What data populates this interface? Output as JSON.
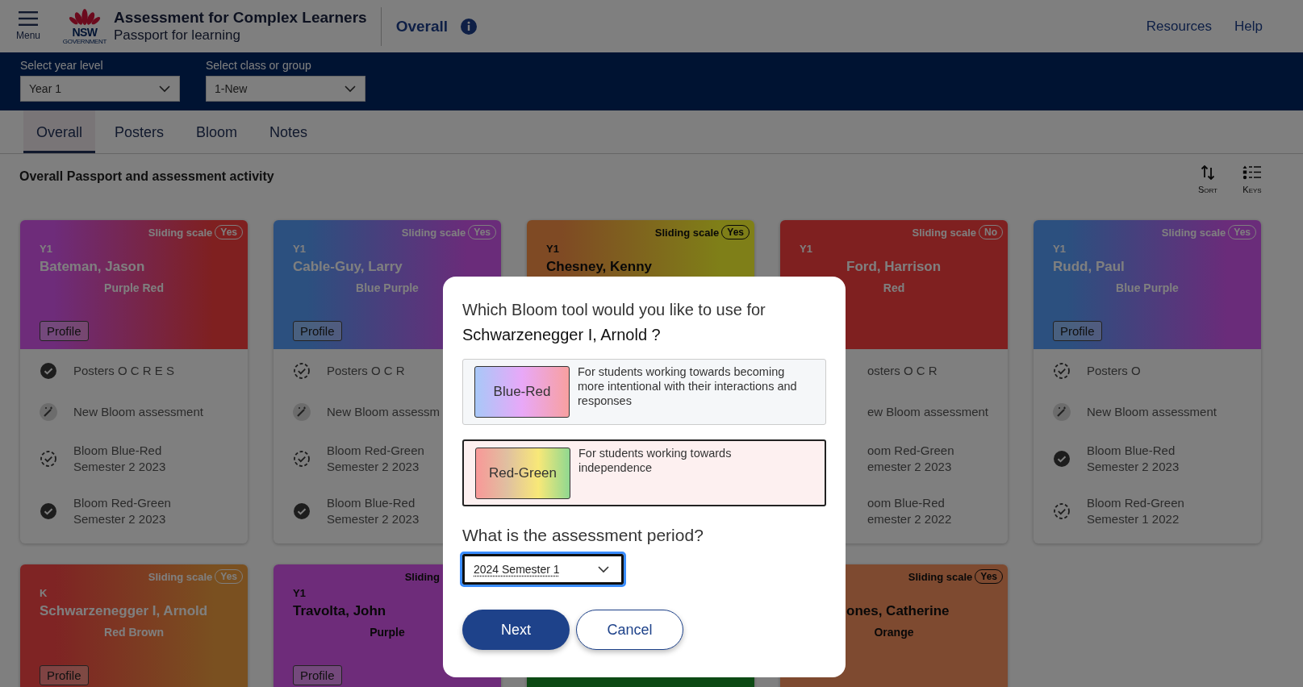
{
  "header": {
    "menu": "Menu",
    "logo": "NSW",
    "logo_sub": "GOVERNMENT",
    "title": "Assessment for Complex Learners",
    "subtitle": "Passport for learning",
    "page": "Overall",
    "links": [
      "Resources",
      "Help"
    ]
  },
  "filters": [
    {
      "label": "Select year level",
      "value": "Year 1"
    },
    {
      "label": "Select class or group",
      "value": "1-New"
    }
  ],
  "tabs": [
    {
      "label": "Overall",
      "selected": true
    },
    {
      "label": "Posters",
      "selected": false
    },
    {
      "label": "Bloom",
      "selected": false
    },
    {
      "label": "Notes",
      "selected": false
    }
  ],
  "section": {
    "title": "Overall Passport and assessment activity",
    "tools": [
      {
        "kind": "sort",
        "label": "Sort"
      },
      {
        "kind": "keys",
        "label": "Keys"
      }
    ]
  },
  "cards": [
    {
      "gradient": [
        {
          "color": "#6e2c7a"
        },
        {
          "color": "#7f2020"
        }
      ],
      "dark_text": false,
      "scale": "Sliding scale",
      "scale_value": "Yes",
      "level": "Y1",
      "name": "Bateman, Jason",
      "band": "Purple Red",
      "profile": "Profile",
      "covered": false,
      "items": [
        {
          "kind": "done",
          "text": "Posters O C R E S"
        },
        {
          "kind": "new",
          "text": "New Bloom assessment"
        },
        {
          "kind": "pending",
          "text": "Bloom Blue-Red",
          "period": "Semester 2 2023"
        },
        {
          "kind": "done",
          "text": "Bloom Red-Green",
          "period": "Semester 2 2023"
        }
      ]
    },
    {
      "gradient": [
        {
          "color": "#2c5088"
        },
        {
          "color": "#6a2c7a"
        }
      ],
      "dark_text": false,
      "scale": "Sliding scale",
      "scale_value": "Yes",
      "level": "Y1",
      "name": "Cable-Guy, Larry",
      "band": "Blue Purple",
      "profile": "Profile",
      "covered": false,
      "items": [
        {
          "kind": "pending",
          "text": "Posters O C R"
        },
        {
          "kind": "new",
          "text": "New Bloom assessm"
        },
        {
          "kind": "pending",
          "text": "Bloom Red-Green",
          "period": "Semester 2 2023"
        },
        {
          "kind": "done",
          "text": "Bloom Blue-Red",
          "period": "Semester 2 2023"
        }
      ]
    },
    {
      "gradient": [
        {
          "color": "#8a4a24"
        },
        {
          "color": "#8a8218"
        }
      ],
      "dark_text": true,
      "scale": "Sliding scale",
      "scale_value": "Yes",
      "level": "Y1",
      "name": "Chesney, Kenny",
      "covered": false
    },
    {
      "gradient": [
        {
          "color": "#7f2020"
        },
        {
          "color": "#7f2020"
        }
      ],
      "dark_text": false,
      "scale": "Sliding scale",
      "scale_value": "No",
      "level": "Y1",
      "name": "Ford, Harrison",
      "band": "Red",
      "covered": true,
      "items": [
        {
          "text": "osters O C R"
        },
        {
          "text": "ew Bloom assessment"
        },
        {
          "text": "oom Red-Green",
          "period": "emester 2 2023"
        },
        {
          "text": "oom Blue-Red",
          "period": "emester 2 2022"
        }
      ]
    },
    {
      "gradient": [
        {
          "color": "#2c5088"
        },
        {
          "color": "#6a2c7a"
        }
      ],
      "dark_text": false,
      "scale": "Sliding scale",
      "scale_value": "Yes",
      "level": "Y1",
      "name": "Rudd, Paul",
      "band": "Blue Purple",
      "profile": "Profile",
      "covered": false,
      "items": [
        {
          "kind": "pending",
          "text": "Posters O"
        },
        {
          "kind": "new",
          "text": "New Bloom assessment"
        },
        {
          "kind": "done",
          "text": "Bloom Blue-Red",
          "period": "Semester 2 2023"
        },
        {
          "kind": "pending",
          "text": "Bloom Red-Green",
          "period": "Semester 1 2022"
        }
      ]
    },
    {
      "gradient": [
        {
          "color": "#7f2424"
        },
        {
          "color": "#7a5020"
        }
      ],
      "dark_text": false,
      "scale": "Sliding scale",
      "scale_value": "Yes",
      "level": "K",
      "name": "Schwarzenegger I, Arnold",
      "band": "Red Brown",
      "profile": "Profile",
      "covered": false
    },
    {
      "gradient": [
        {
          "color": "#6e2c7a"
        },
        {
          "color": "#6e2c7a"
        }
      ],
      "dark_text": true,
      "scale": "Sliding",
      "level": "Y1",
      "name": "Travolta, John",
      "band": "Purple",
      "profile": "Profile",
      "covered": false
    },
    {
      "gradient": [
        {
          "color": "#0c4a14"
        },
        {
          "color": "#0c4a14"
        }
      ]
    },
    {
      "gradient": [
        {
          "color": "#7e4a30"
        },
        {
          "color": "#7e4a30"
        }
      ],
      "dark_text": true,
      "scale": "Sliding scale",
      "scale_value": "Yes",
      "name": "ones, Catherine",
      "band": "Orange",
      "covered": true
    }
  ],
  "dialog": {
    "question": "Which Bloom tool would you like to use for",
    "student": "Schwarzenegger I, Arnold ?",
    "options": [
      {
        "kind": "blue-red",
        "name": "Blue-Red",
        "description": "For students working towards becoming more intentional with their interactions and responses",
        "selected": false
      },
      {
        "kind": "red-green",
        "name": "Red-Green",
        "description": "For students working towards independence",
        "selected": true
      }
    ],
    "period_label": "What is the assessment period?",
    "period": "2024 Semester 1",
    "buttons": [
      {
        "kind": "primary",
        "label": "Next"
      },
      {
        "kind": "secondary",
        "label": "Cancel"
      }
    ]
  }
}
